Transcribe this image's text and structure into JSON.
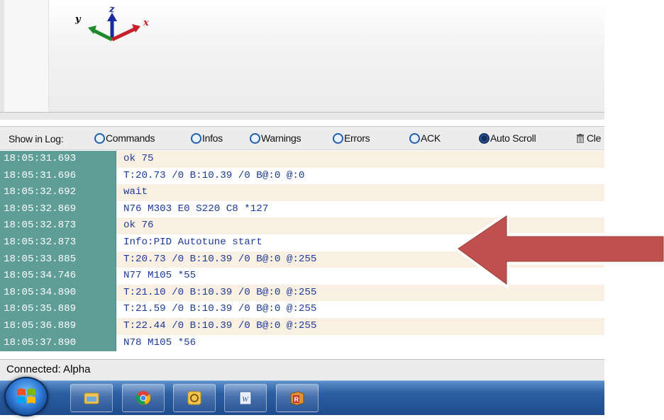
{
  "toolbar": {
    "show_in_log_label": "Show in Log:",
    "toggles": [
      {
        "label": "Commands",
        "checked": false
      },
      {
        "label": "Infos",
        "checked": false
      },
      {
        "label": "Warnings",
        "checked": false
      },
      {
        "label": "Errors",
        "checked": false
      },
      {
        "label": "ACK",
        "checked": false
      },
      {
        "label": "Auto Scroll",
        "checked": true
      }
    ],
    "clear_label": "Cle"
  },
  "axes": {
    "x": "x",
    "y": "y",
    "z": "z",
    "x_color": "#c8202a",
    "y_color": "#1f8a2a",
    "z_color": "#1a2a9c"
  },
  "log": {
    "rows": [
      {
        "time": "18:05:31.693",
        "msg": "ok 75"
      },
      {
        "time": "18:05:31.696",
        "msg": "T:20.73 /0 B:10.39 /0 B@:0 @:0"
      },
      {
        "time": "18:05:32.692",
        "msg": "wait"
      },
      {
        "time": "18:05:32.869",
        "msg": "N76 M303 E0 S220 C8 *127"
      },
      {
        "time": "18:05:32.873",
        "msg": "ok 76"
      },
      {
        "time": "18:05:32.873",
        "msg": "Info:PID Autotune start"
      },
      {
        "time": "18:05:33.885",
        "msg": "T:20.73 /0 B:10.39 /0 B@:0 @:255"
      },
      {
        "time": "18:05:34.746",
        "msg": "N77 M105 *55"
      },
      {
        "time": "18:05:34.890",
        "msg": "T:21.10 /0 B:10.39 /0 B@:0 @:255"
      },
      {
        "time": "18:05:35.889",
        "msg": "T:21.59 /0 B:10.39 /0 B@:0 @:255"
      },
      {
        "time": "18:05:36.889",
        "msg": "T:22.44 /0 B:10.39 /0 B@:0 @:255"
      },
      {
        "time": "18:05:37.890",
        "msg": "N78 M105 *56"
      }
    ]
  },
  "status": {
    "text": "Connected: Alpha"
  },
  "annotation": {
    "arrow_color": "#c0504d"
  },
  "taskbar": {
    "items": [
      {
        "icon": "file-explorer-icon"
      },
      {
        "icon": "chrome-icon"
      },
      {
        "icon": "outlook-icon"
      },
      {
        "icon": "word-icon"
      },
      {
        "icon": "repetier-icon"
      }
    ]
  }
}
